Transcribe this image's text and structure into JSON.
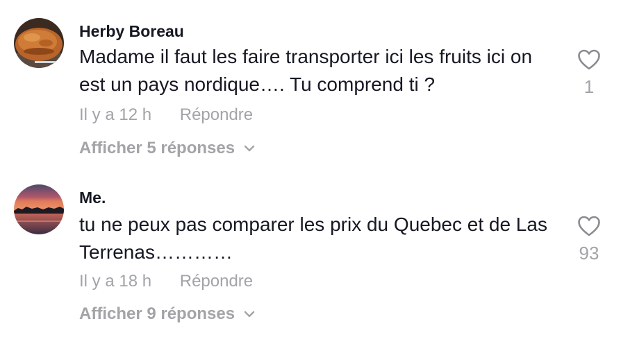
{
  "comments": [
    {
      "username": "Herby Boreau",
      "text": "Madame il faut les faire transporter ici les fruits ici on est un pays nordique…. Tu comprend ti ?",
      "time": "Il y a 12 h",
      "reply_label": "Répondre",
      "view_replies": "Afficher 5 réponses",
      "like_count": "1",
      "avatar": "bread-photo-avatar"
    },
    {
      "username": "Me.",
      "text": "tu ne peux pas comparer les prix du Quebec et de Las Terrenas…………",
      "time": "Il y a 18 h",
      "reply_label": "Répondre",
      "view_replies": "Afficher 9 réponses",
      "like_count": "93",
      "avatar": "sunset-photo-avatar"
    }
  ],
  "colors": {
    "primary_text": "#161823",
    "secondary_text": "#a3a3a8",
    "background": "#ffffff"
  }
}
